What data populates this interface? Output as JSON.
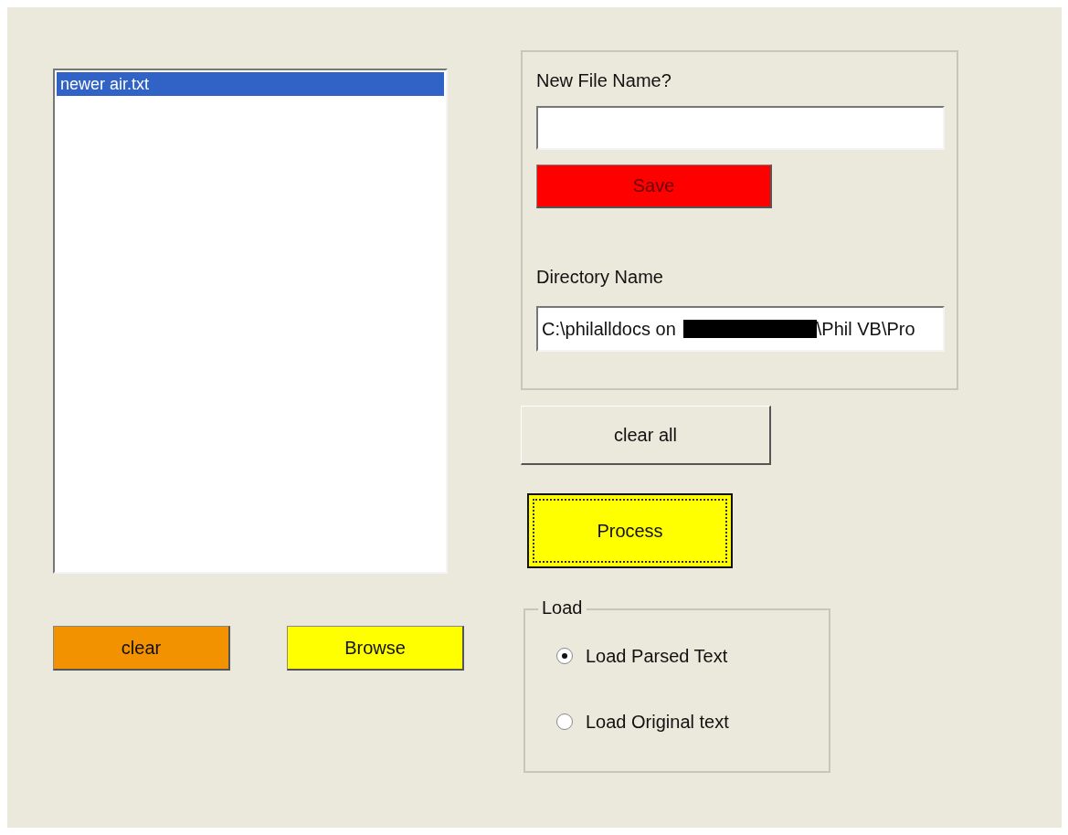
{
  "file_list": {
    "items": [
      {
        "label": "newer air.txt",
        "selected": true
      }
    ]
  },
  "list_buttons": [
    {
      "label": "clear",
      "kind": "orange"
    },
    {
      "label": "Browse",
      "kind": "yellow"
    }
  ],
  "save_panel": {
    "new_file_label": "New File Name?",
    "save_button": "Save",
    "directory_label": "Directory Name",
    "directory_field": {
      "value_start": "C:\\philalldocs on",
      "redacted": true,
      "value_end": "\\Phil VB\\Pro"
    }
  },
  "clear_all_button": "clear all",
  "process_button": {
    "label": "Process",
    "focused": true
  },
  "load_group": {
    "title": "Load",
    "options": [
      {
        "label": "Load Parsed Text",
        "selected": true
      },
      {
        "label": "Load Original text",
        "selected": false
      }
    ]
  }
}
